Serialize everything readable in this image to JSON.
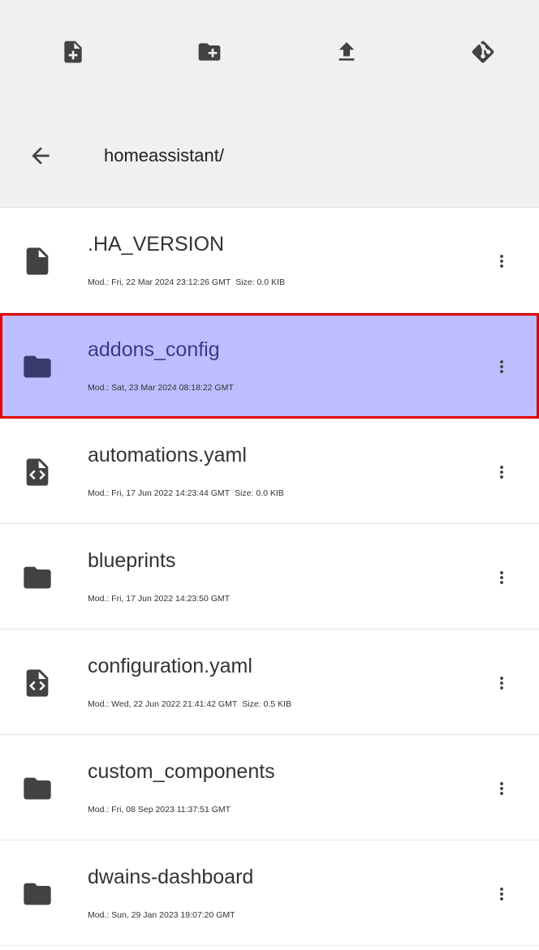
{
  "header": {
    "path": "homeassistant/"
  },
  "files": [
    {
      "name": ".HA_VERSION",
      "type": "file",
      "modified": "Mod.: Fri, 22 Mar 2024 23:12:26 GMT",
      "size": "Size: 0.0 KIB",
      "selected": false
    },
    {
      "name": "addons_config",
      "type": "folder",
      "modified": "Mod.: Sat, 23 Mar 2024 08:18:22 GMT",
      "size": "",
      "selected": true
    },
    {
      "name": "automations.yaml",
      "type": "code-file",
      "modified": "Mod.: Fri, 17 Jun 2022 14:23:44 GMT",
      "size": "Size: 0.0 KIB",
      "selected": false
    },
    {
      "name": "blueprints",
      "type": "folder",
      "modified": "Mod.: Fri, 17 Jun 2022 14:23:50 GMT",
      "size": "",
      "selected": false
    },
    {
      "name": "configuration.yaml",
      "type": "code-file",
      "modified": "Mod.: Wed, 22 Jun 2022 21:41:42 GMT",
      "size": "Size: 0.5 KIB",
      "selected": false
    },
    {
      "name": "custom_components",
      "type": "folder",
      "modified": "Mod.: Fri, 08 Sep 2023 11:37:51 GMT",
      "size": "",
      "selected": false
    },
    {
      "name": "dwains-dashboard",
      "type": "folder",
      "modified": "Mod.: Sun, 29 Jan 2023 19:07:20 GMT",
      "size": "",
      "selected": false
    }
  ],
  "colors": {
    "header_bg": "#f0f0f0",
    "icon": "#424242",
    "selected_bg": "#bdbdff",
    "selected_icon": "#3a3a6e",
    "selected_border": "#e00000"
  }
}
